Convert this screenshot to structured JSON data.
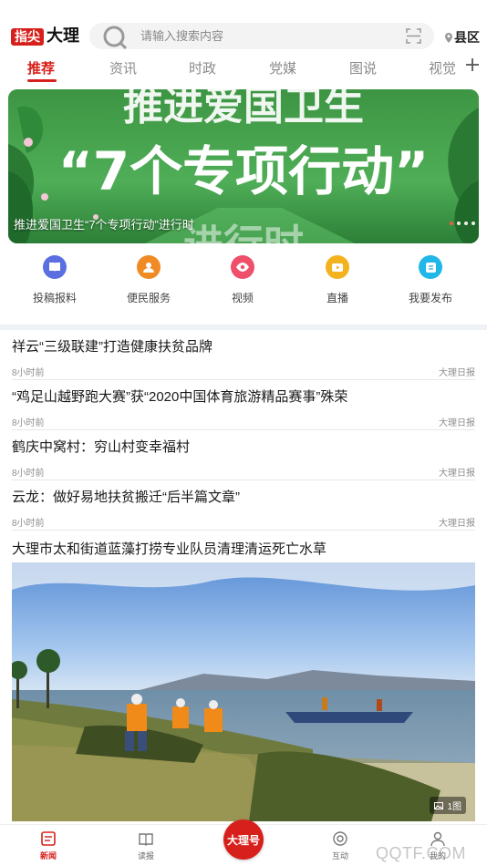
{
  "header": {
    "logo_red": "指尖",
    "logo_black": "大理",
    "search_placeholder": "请输入搜索内容",
    "county_label": "县区"
  },
  "tabs": [
    {
      "label": "推荐",
      "active": true
    },
    {
      "label": "资讯"
    },
    {
      "label": "时政"
    },
    {
      "label": "党媒"
    },
    {
      "label": "图说"
    },
    {
      "label": "视觉"
    }
  ],
  "banner": {
    "headline_top": "推进爱国卫生",
    "headline_main": "“7个专项行动”",
    "headline_bottom": "进行时",
    "caption": "推进爱国卫生“7个专项行动”进行时",
    "slide_count": 4,
    "active_slide": 1
  },
  "quick_links": [
    {
      "label": "投稿报料",
      "icon": "book-icon",
      "color": "#5b6fe0"
    },
    {
      "label": "便民服务",
      "icon": "service-icon",
      "color": "#f08a24"
    },
    {
      "label": "视频",
      "icon": "eye-icon",
      "color": "#ef4f6a"
    },
    {
      "label": "直播",
      "icon": "live-icon",
      "color": "#f4b21e"
    },
    {
      "label": "我要发布",
      "icon": "publish-icon",
      "color": "#1fb6e8"
    }
  ],
  "news": [
    {
      "title": "祥云“三级联建”打造健康扶贫品牌",
      "time": "8小时前",
      "source": "大理日报"
    },
    {
      "title": "“鸡足山越野跑大赛”获“2020中国体育旅游精品赛事”殊荣",
      "time": "8小时前",
      "source": "大理日报"
    },
    {
      "title": "鹤庆中窝村：穷山村变幸福村",
      "time": "8小时前",
      "source": "大理日报"
    },
    {
      "title": "云龙：做好易地扶贫搬迁“后半篇文章”",
      "time": "8小时前",
      "source": "大理日报"
    }
  ],
  "feature": {
    "title": "大理市太和街道蓝藻打捞专业队员清理清运死亡水草",
    "photo_count": "1图"
  },
  "bottom_nav": [
    {
      "label": "新闻",
      "icon": "news-icon",
      "active": true
    },
    {
      "label": "读报",
      "icon": "newspaper-icon"
    },
    {
      "label": "大理号",
      "icon": "center-icon"
    },
    {
      "label": "互动",
      "icon": "interact-icon"
    },
    {
      "label": "我的",
      "icon": "user-icon"
    }
  ],
  "watermark": "QQTF.COM",
  "colors": {
    "accent": "#d7201b",
    "banner_green": "#3f9a46"
  }
}
